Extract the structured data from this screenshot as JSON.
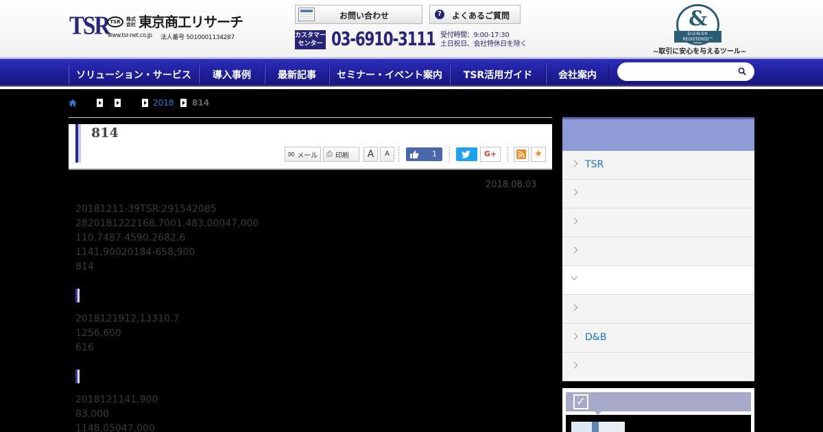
{
  "header": {
    "logo_text": "TSR",
    "emblem_text": "TSR",
    "kabushiki": "株式会社",
    "company_name": "東京商工リサーチ",
    "url": "www.tsr-net.co.jp",
    "corp_number": "法人番号 5010001134287",
    "contact_label": "お問い合わせ",
    "faq_label": "よくあるご質問",
    "customer_center": "カスタマーセンター",
    "phone": "03-6910-3111",
    "hours_line1": "受付時間：9:00-17:30",
    "hours_line2": "土日祝日、会社特休日を除く",
    "duns_ribbon": "D-U-N-S® REGISTERED™",
    "duns_tagline": "~取引に安心を与えるツール~"
  },
  "nav": {
    "items": [
      {
        "label": "ソリューション・サービス"
      },
      {
        "label": "導入事例"
      },
      {
        "label": "最新記事"
      },
      {
        "label": "セミナー・イベント案内"
      },
      {
        "label": "TSR活用ガイド"
      },
      {
        "label": "会社案内"
      }
    ],
    "search_placeholder": ""
  },
  "breadcrumb": {
    "year": "2018",
    "current": "814"
  },
  "article": {
    "title": "814",
    "tools": {
      "mail": "メール",
      "print": "印刷",
      "font_large": "A",
      "font_small": "A",
      "like_count": "1",
      "gplus": "G+"
    },
    "date": "2018.08.03",
    "paragraphs": [
      [
        "20181211-39TSR:291542085",
        "2820181222168,7001.483,00047,000",
        "110.7487.4590.2682.6",
        "1141,90020184-658,900",
        "814"
      ],
      [
        "2018121912,13310.7",
        "1256,600",
        "616"
      ],
      [
        "2018121141,900",
        "83,000",
        "1148,05047,000"
      ]
    ]
  },
  "sidebar": {
    "items": [
      {
        "label": "TSR",
        "active": false
      },
      {
        "label": "",
        "active": false
      },
      {
        "label": "",
        "active": false
      },
      {
        "label": "",
        "active": false
      },
      {
        "label": "",
        "active": true
      },
      {
        "label": "",
        "active": false
      },
      {
        "label": "D&B",
        "active": false
      },
      {
        "label": "",
        "active": false
      }
    ]
  },
  "colors": {
    "brand_navy": "#27257a",
    "nav_blue": "#1e1e99",
    "link_blue": "#1a73c4",
    "sidebar_head": "#8e9bd6"
  }
}
